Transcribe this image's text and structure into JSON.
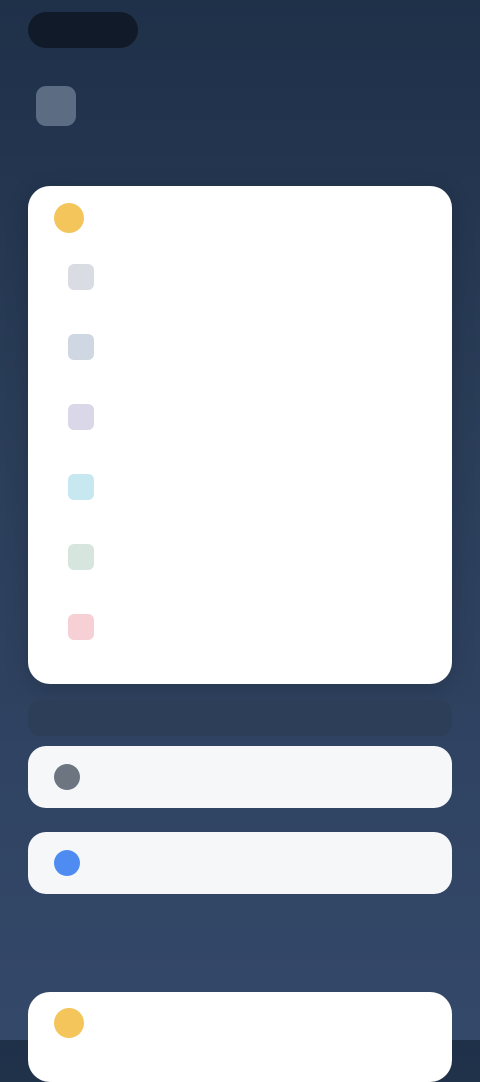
{
  "status": {
    "pill_label": ""
  },
  "main_card": {
    "header_title": "",
    "rows": [
      {
        "label": "",
        "value": "",
        "icon": "bell-icon",
        "color": "#d9dde3"
      },
      {
        "label": "",
        "value": "",
        "icon": "shield-icon",
        "color": "#cfd7e2"
      },
      {
        "label": "",
        "value": "",
        "icon": "lock-icon",
        "color": "#dad7e8"
      },
      {
        "label": "",
        "value": "",
        "icon": "sync-icon",
        "color": "#c7e7f1"
      },
      {
        "label": "",
        "value": "",
        "icon": "gear-icon",
        "color": "#d6e6de"
      },
      {
        "label": "",
        "value": "",
        "icon": "heart-icon",
        "color": "#f7d0d6"
      }
    ]
  },
  "section": {
    "label": ""
  },
  "sub_cards": [
    {
      "text": "",
      "icon": "account-icon",
      "color": "#6d7581"
    },
    {
      "text": "",
      "icon": "info-icon",
      "color": "#4f8cf2"
    }
  ],
  "bottom_card": {
    "text": "",
    "icon": "star-icon",
    "color": "#f3c55a"
  }
}
